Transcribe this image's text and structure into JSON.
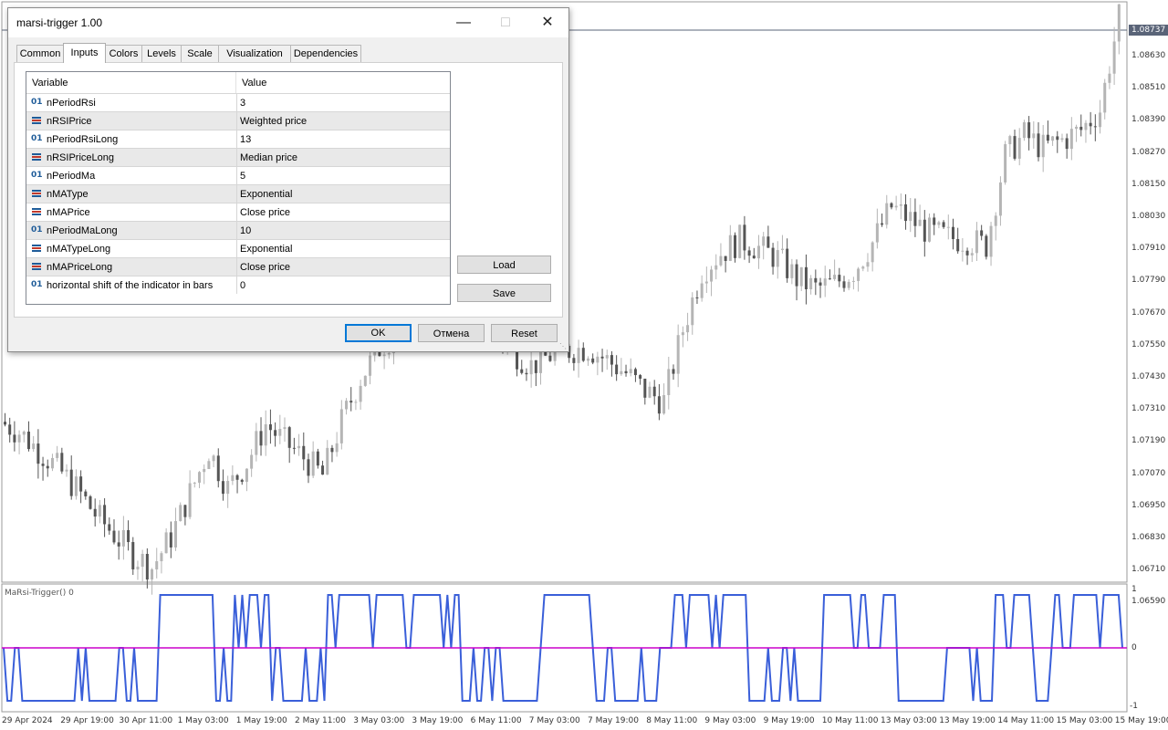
{
  "dialog": {
    "title": "marsi-trigger 1.00",
    "tabs": [
      "Common",
      "Inputs",
      "Colors",
      "Levels",
      "Scale",
      "Visualization",
      "Dependencies"
    ],
    "active_tab": "Inputs",
    "columns": {
      "variable": "Variable",
      "value": "Value"
    },
    "rows": [
      {
        "type": "int",
        "icon": "01",
        "name": "nPeriodRsi",
        "value": "3"
      },
      {
        "type": "enum",
        "icon": "enum",
        "name": "nRSIPrice",
        "value": "Weighted price"
      },
      {
        "type": "int",
        "icon": "01",
        "name": "nPeriodRsiLong",
        "value": "13"
      },
      {
        "type": "enum",
        "icon": "enum",
        "name": "nRSIPriceLong",
        "value": "Median price"
      },
      {
        "type": "int",
        "icon": "01",
        "name": "nPeriodMa",
        "value": "5"
      },
      {
        "type": "enum",
        "icon": "enum",
        "name": "nMAType",
        "value": "Exponential"
      },
      {
        "type": "enum",
        "icon": "enum",
        "name": "nMAPrice",
        "value": "Close price"
      },
      {
        "type": "int",
        "icon": "01",
        "name": "nPeriodMaLong",
        "value": "10"
      },
      {
        "type": "enum",
        "icon": "enum",
        "name": "nMATypeLong",
        "value": "Exponential"
      },
      {
        "type": "enum",
        "icon": "enum",
        "name": "nMAPriceLong",
        "value": "Close price"
      },
      {
        "type": "int",
        "icon": "01",
        "name": "horizontal shift of the indicator in bars",
        "value": "0"
      }
    ],
    "load_label": "Load",
    "save_label": "Save",
    "ok_label": "OK",
    "cancel_label": "Отмена",
    "reset_label": "Reset"
  },
  "chart": {
    "current_price": "1.08737",
    "y_ticks": [
      "1.08630",
      "1.08510",
      "1.08390",
      "1.08270",
      "1.08150",
      "1.08030",
      "1.07910",
      "1.07790",
      "1.07670",
      "1.07550",
      "1.07430",
      "1.07310",
      "1.07190",
      "1.07070",
      "1.06950",
      "1.06830",
      "1.06710",
      "1.06590"
    ],
    "x_ticks": [
      "29 Apr 2024",
      "29 Apr 19:00",
      "30 Apr 11:00",
      "1 May 03:00",
      "1 May 19:00",
      "2 May 11:00",
      "3 May 03:00",
      "3 May 19:00",
      "6 May 11:00",
      "7 May 03:00",
      "7 May 19:00",
      "8 May 11:00",
      "9 May 03:00",
      "9 May 19:00",
      "10 May 11:00",
      "13 May 03:00",
      "13 May 19:00",
      "14 May 11:00",
      "15 May 03:00",
      "15 May 19:00"
    ],
    "indicator_label": "MaRsi-Trigger() 0",
    "indicator_ticks": [
      "1",
      "0",
      "-1"
    ],
    "colors": {
      "up_candle": "#b5b5b5",
      "down_candle": "#555555",
      "indicator_line": "#3a5fd9",
      "zero_line": "#cc00cc",
      "price_tag": "#5a6478"
    }
  },
  "chart_data": {
    "type": "line",
    "title": "",
    "x": [
      0,
      1,
      2,
      3,
      4,
      5,
      6,
      7,
      8,
      9,
      10,
      11,
      12,
      13,
      14,
      15,
      16,
      17,
      18,
      19,
      20,
      21,
      22,
      23,
      24,
      25,
      26,
      27,
      28,
      29,
      30,
      31,
      32,
      33,
      34,
      35,
      36,
      37,
      38,
      39,
      40,
      41,
      42,
      43,
      44,
      45,
      46,
      47,
      48,
      49,
      50,
      51,
      52,
      53,
      54,
      55,
      56,
      57,
      58,
      59
    ],
    "series": [
      {
        "values": [
          1.0716,
          1.0712,
          1.0705,
          1.0698,
          1.069,
          1.068,
          1.0672,
          1.0664,
          1.0659,
          1.0671,
          1.0688,
          1.0705,
          1.069,
          1.07,
          1.0715,
          1.0708,
          1.0702,
          1.0695,
          1.0716,
          1.0733,
          1.0745,
          1.0752,
          1.0758,
          1.077,
          1.0775,
          1.076,
          1.0752,
          1.0744,
          1.0738,
          1.0742,
          1.0744,
          1.0745,
          1.074,
          1.0735,
          1.0728,
          1.0724,
          1.0752,
          1.0775,
          1.0782,
          1.0787,
          1.0784,
          1.078,
          1.0772,
          1.0768,
          1.077,
          1.0775,
          1.0786,
          1.08,
          1.0795,
          1.079,
          1.0788,
          1.0787,
          1.0785,
          1.082,
          1.0828,
          1.0823,
          1.0826,
          1.083,
          1.0838,
          1.0874
        ]
      }
    ],
    "ylim": [
      1.0654,
      1.0878
    ],
    "indicator_ylim": [
      -1,
      1
    ]
  }
}
